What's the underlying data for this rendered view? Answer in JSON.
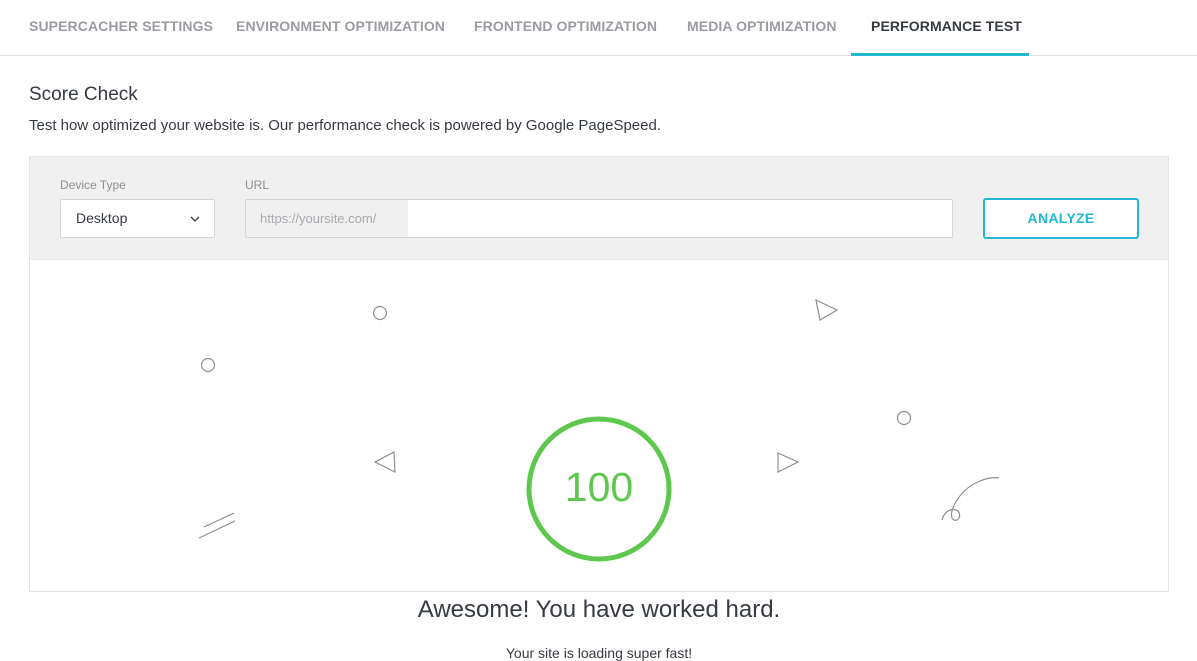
{
  "tabs": [
    {
      "label": "SUPERCACHER SETTINGS",
      "active": false
    },
    {
      "label": "ENVIRONMENT OPTIMIZATION",
      "active": false
    },
    {
      "label": "FRONTEND OPTIMIZATION",
      "active": false
    },
    {
      "label": "MEDIA OPTIMIZATION",
      "active": false
    },
    {
      "label": "PERFORMANCE TEST",
      "active": true
    }
  ],
  "section": {
    "title": "Score Check",
    "description": "Test how optimized your website is. Our performance check is powered by Google PageSpeed."
  },
  "form": {
    "device_type_label": "Device Type",
    "device_type_value": "Desktop",
    "url_label": "URL",
    "url_prefix": "https://yoursite.com/",
    "url_value": "",
    "analyze_label": "ANALYZE"
  },
  "result": {
    "score": "100",
    "headline": "Awesome! You have worked hard.",
    "message": "Your site is loading super fast!"
  },
  "colors": {
    "accent": "#22b8d1",
    "score_good": "#5ec84e",
    "text": "#363a41"
  },
  "icons": {
    "select_chevron": "chevron-down-icon"
  }
}
